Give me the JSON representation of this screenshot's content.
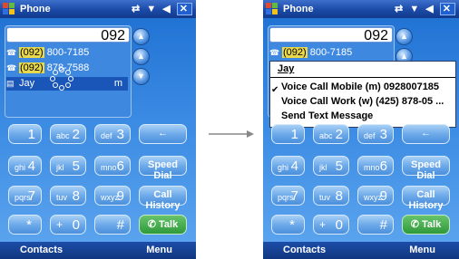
{
  "title": "Phone",
  "status_icons": [
    "connectivity-icon",
    "signal-icon",
    "volume-icon",
    "close-icon"
  ],
  "number": "092",
  "entries": [
    {
      "area": "(092)",
      "rest": " 800-7185"
    },
    {
      "area": "(092)",
      "rest": " 878-7588"
    }
  ],
  "selected_entry": {
    "name": "Jay",
    "suffix": "m"
  },
  "keys": [
    {
      "sub": "",
      "main": "1"
    },
    {
      "sub": "abc",
      "main": "2"
    },
    {
      "sub": "def",
      "main": "3"
    },
    {
      "sub": "ghi",
      "main": "4"
    },
    {
      "sub": "jkl",
      "main": "5"
    },
    {
      "sub": "mno",
      "main": "6"
    },
    {
      "sub": "pqrs",
      "main": "7"
    },
    {
      "sub": "tuv",
      "main": "8"
    },
    {
      "sub": "wxyz",
      "main": "9"
    },
    {
      "sub": "*",
      "main": ""
    },
    {
      "sub": "+",
      "main": "0"
    },
    {
      "sub": "",
      "main": "#"
    }
  ],
  "side_keys": {
    "back": "←",
    "speed_dial": "Speed Dial",
    "call_history": "Call History",
    "talk": "Talk"
  },
  "softkeys": {
    "left": "Contacts",
    "right": "Menu"
  },
  "popup_menu": {
    "header": "Jay",
    "items": [
      "Voice Call Mobile (m) 0928007185",
      "Voice Call Work (w) (425) 878-05 ...",
      "Send Text Message"
    ]
  }
}
